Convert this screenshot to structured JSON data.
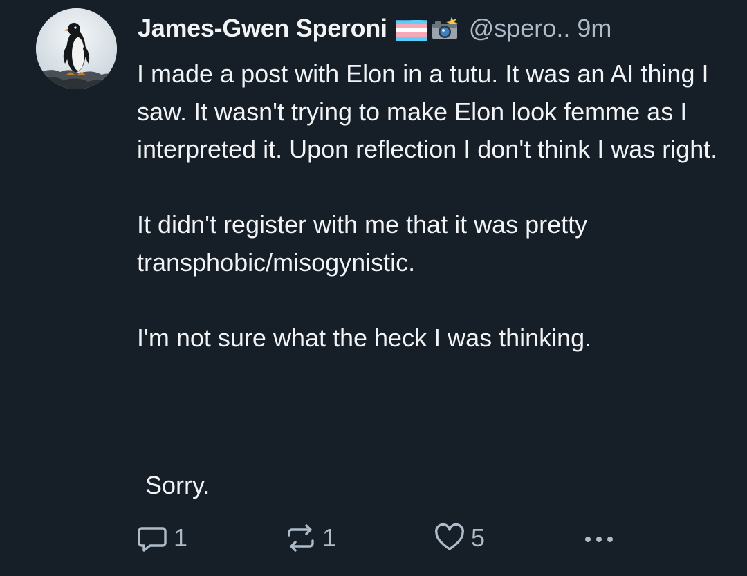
{
  "post": {
    "author": {
      "display_name": "James-Gwen Speroni",
      "handle": "@spero..",
      "avatar_icon": "penguin-avatar",
      "badges": [
        "transgender-flag-icon",
        "camera-flash-icon"
      ]
    },
    "timestamp": "9m",
    "body": {
      "paragraph_1": "I made a post with Elon in a tutu. It was an AI thing I saw. It wasn't trying to make Elon look femme as I interpreted it. Upon reflection I don't think I was right.",
      "paragraph_2": "It didn't register with me that it was pretty transphobic/misogynistic.",
      "paragraph_3": "I'm not sure what the heck I was thinking.",
      "paragraph_4": "Sorry."
    },
    "actions": {
      "reply_count": "1",
      "repost_count": "1",
      "like_count": "5",
      "more_icon": "more-horizontal-icon"
    }
  },
  "colors": {
    "background": "#161e27",
    "text_primary": "#f1f3f5",
    "text_secondary": "#aebbc9"
  }
}
